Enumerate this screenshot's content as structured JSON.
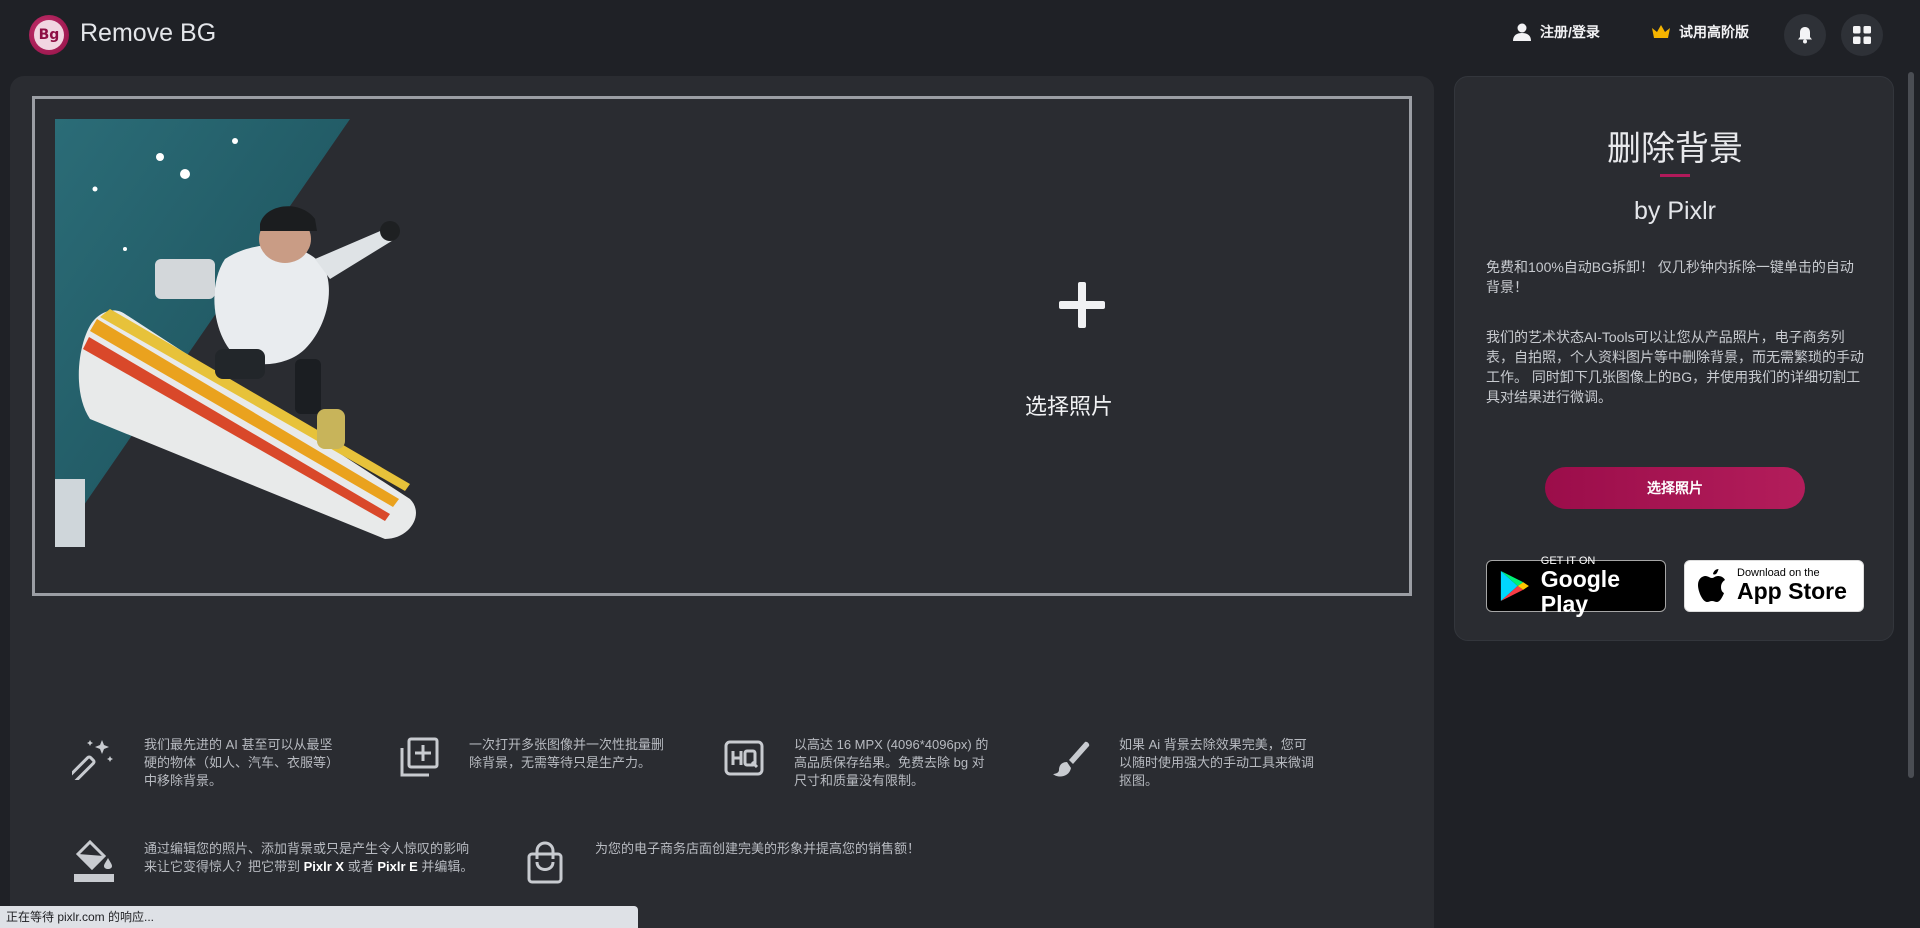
{
  "header": {
    "app_title": "Remove BG",
    "logo_text": "Bg",
    "login_label": "注册/登录",
    "premium_label": "试用高阶版"
  },
  "dropzone": {
    "choose_label": "选择照片"
  },
  "features": [
    {
      "icon": "magic-wand-icon",
      "text": "我们最先进的 AI 甚至可以从最坚硬的物体（如人、汽车、衣服等）中移除背景。"
    },
    {
      "icon": "batch-add-icon",
      "text": "一次打开多张图像并一次性批量删除背景，无需等待只是生产力。"
    },
    {
      "icon": "hq-icon",
      "text": "以高达 16 MPX (4096*4096px) 的高品质保存结果。免费去除 bg 对尺寸和质量没有限制。"
    },
    {
      "icon": "brush-icon",
      "text": "如果 Ai 背景去除效果完美，您可以随时使用强大的手动工具来微调抠图。"
    },
    {
      "icon": "paint-bucket-icon",
      "text_before": "通过编辑您的照片、添加背景或只是产生令人惊叹的影响来让它变得惊人？把它带到 ",
      "bold1": "Pixlr X",
      "middle": " 或者 ",
      "bold2": "Pixlr E",
      "text_after": " 并编辑。"
    },
    {
      "icon": "shopping-bag-icon",
      "text": "为您的电子商务店面创建完美的形象并提高您的销售额！"
    }
  ],
  "side": {
    "title": "删除背景",
    "by": "by Pixlr",
    "desc1": "免费和100%自动BG拆卸！ 仅几秒钟内拆除一键单击的自动背景！",
    "desc2": "我们的艺术状态AI-Tools可以让您从产品照片，电子商务列表，自拍照，个人资料图片等中删除背景，而无需繁琐的手动工作。 同时卸下几张图像上的BG，并使用我们的详细切割工具对结果进行微调。",
    "choose_button": "选择照片",
    "google_small": "GET IT ON",
    "google_big": "Google Play",
    "apple_small": "Download on the",
    "apple_big": "App Store"
  },
  "status_bar": "正在等待 pixlr.com 的响应...",
  "colors": {
    "background": "#1f2126",
    "panel": "#2a2c31",
    "accent": "#b11a5a",
    "premium_crown": "#f5b400"
  }
}
